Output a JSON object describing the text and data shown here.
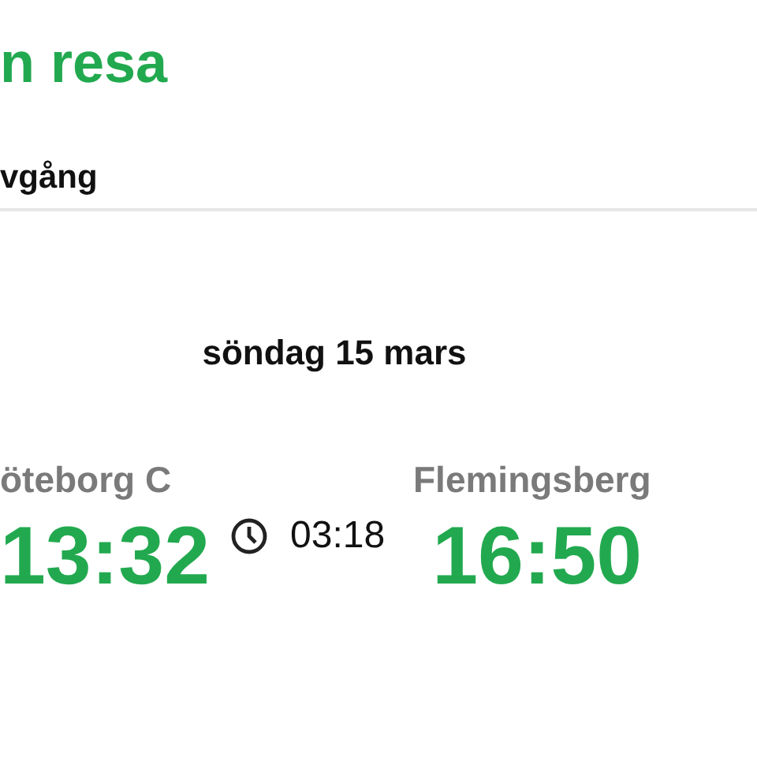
{
  "header": {
    "title": "n resa",
    "subtitle": "vgång"
  },
  "journey": {
    "date": "söndag 15 mars",
    "from": {
      "station": "öteborg C",
      "time": "13:32"
    },
    "duration": "03:18",
    "to": {
      "station": "Flemingsberg",
      "time": "16:50"
    }
  }
}
